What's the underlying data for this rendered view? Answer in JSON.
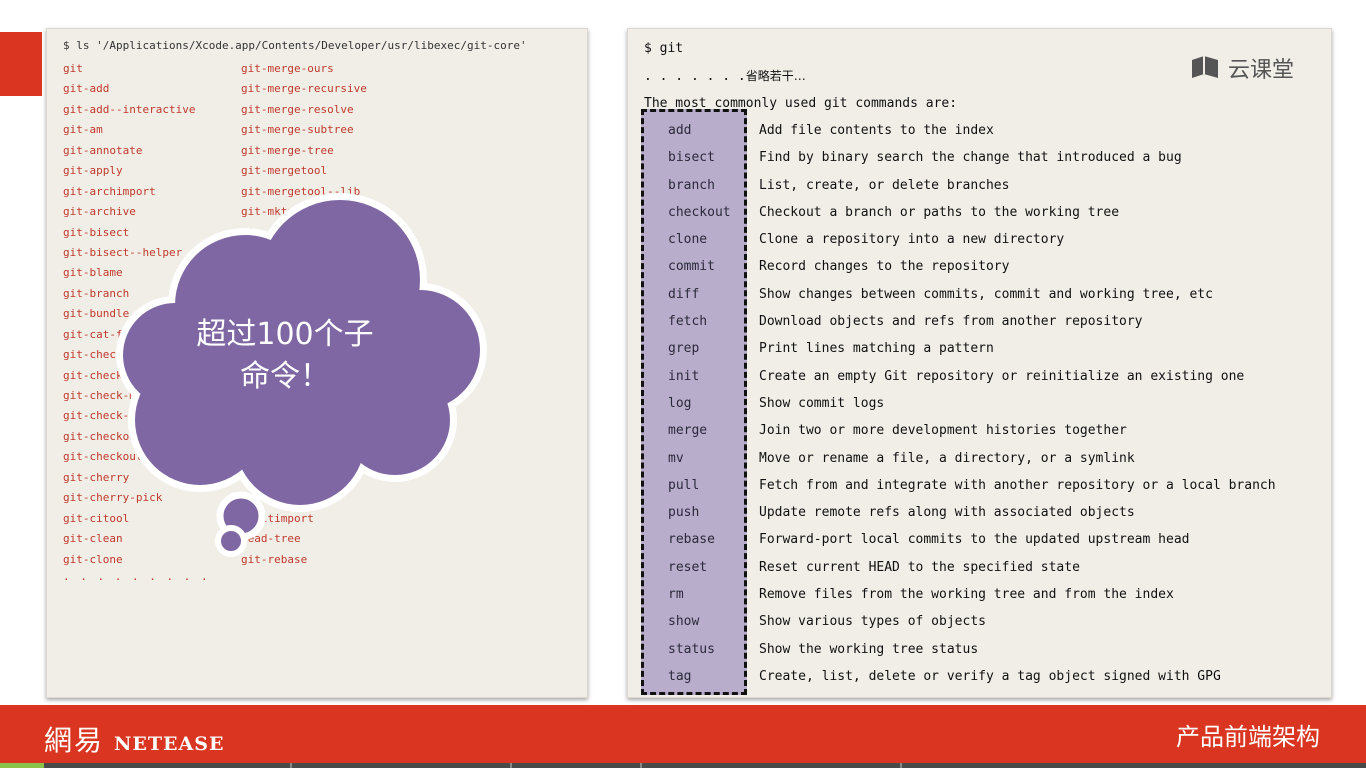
{
  "left": {
    "command": "$ ls '/Applications/Xcode.app/Contents/Developer/usr/libexec/git-core'",
    "col1": [
      "git",
      "git-add",
      "git-add--interactive",
      "git-am",
      "git-annotate",
      "git-apply",
      "git-archimport",
      "git-archive",
      "git-bisect",
      "git-bisect--helper",
      "git-blame",
      "git-branch",
      "git-bundle",
      "git-cat-fil",
      "git-check-",
      "git-check-",
      "git-check-ma",
      "git-check-r",
      "git-checkou",
      "git-checkout-i",
      "git-cherry",
      "git-cherry-pick",
      "git-citool",
      "git-clean",
      "git-clone"
    ],
    "col2": [
      "git-merge-ours",
      "git-merge-recursive",
      "git-merge-resolve",
      "git-merge-subtree",
      "git-merge-tree",
      "git-mergetool",
      "git-mergetool--lib",
      "git-mktag",
      "gi",
      "",
      "",
      "",
      "",
      "",
      "",
      "",
      "",
      "",
      "",
      "",
      "",
      "",
      "quiltimport",
      "read-tree",
      "git-rebase"
    ],
    "more": ". . . . . . . . ."
  },
  "cloud": {
    "line1": "超过100个子",
    "line2": "命令！",
    "fill": "#7f67a4"
  },
  "right": {
    "prompt": "$ git",
    "dots": ". . . . . . .",
    "omitted": "省略若干…",
    "heading": "The most commonly used git commands are:",
    "commands": [
      {
        "name": "add",
        "desc": "Add file contents to the index"
      },
      {
        "name": "bisect",
        "desc": "Find by binary search the change that introduced a bug"
      },
      {
        "name": "branch",
        "desc": "List, create, or delete branches"
      },
      {
        "name": "checkout",
        "desc": "Checkout a branch or paths to the working tree"
      },
      {
        "name": "clone",
        "desc": "Clone a repository into a new directory"
      },
      {
        "name": "commit",
        "desc": "Record changes to the repository"
      },
      {
        "name": "diff",
        "desc": "Show changes between commits, commit and working tree, etc"
      },
      {
        "name": "fetch",
        "desc": "Download objects and refs from another repository"
      },
      {
        "name": "grep",
        "desc": "Print lines matching a pattern"
      },
      {
        "name": "init",
        "desc": "Create an empty Git repository or reinitialize an existing one"
      },
      {
        "name": "log",
        "desc": "Show commit logs"
      },
      {
        "name": "merge",
        "desc": "Join two or more development histories together"
      },
      {
        "name": "mv",
        "desc": "Move or rename a file, a directory, or a symlink"
      },
      {
        "name": "pull",
        "desc": "Fetch from and integrate with another repository or a local branch"
      },
      {
        "name": "push",
        "desc": "Update remote refs along with associated objects"
      },
      {
        "name": "rebase",
        "desc": "Forward-port local commits to the updated upstream head"
      },
      {
        "name": "reset",
        "desc": "Reset current HEAD to the specified state"
      },
      {
        "name": "rm",
        "desc": "Remove files from the working tree and from the index"
      },
      {
        "name": "show",
        "desc": "Show various types of objects"
      },
      {
        "name": "status",
        "desc": "Show the working tree status"
      },
      {
        "name": "tag",
        "desc": "Create, list, delete or verify a tag object signed with GPG"
      }
    ]
  },
  "watermark": {
    "text": "云课堂",
    "icon": "book-icon"
  },
  "footer": {
    "brand_zh": "網易",
    "brand_en": "NETEASE",
    "right_text": "产品前端架构",
    "bg": "#da3520"
  }
}
